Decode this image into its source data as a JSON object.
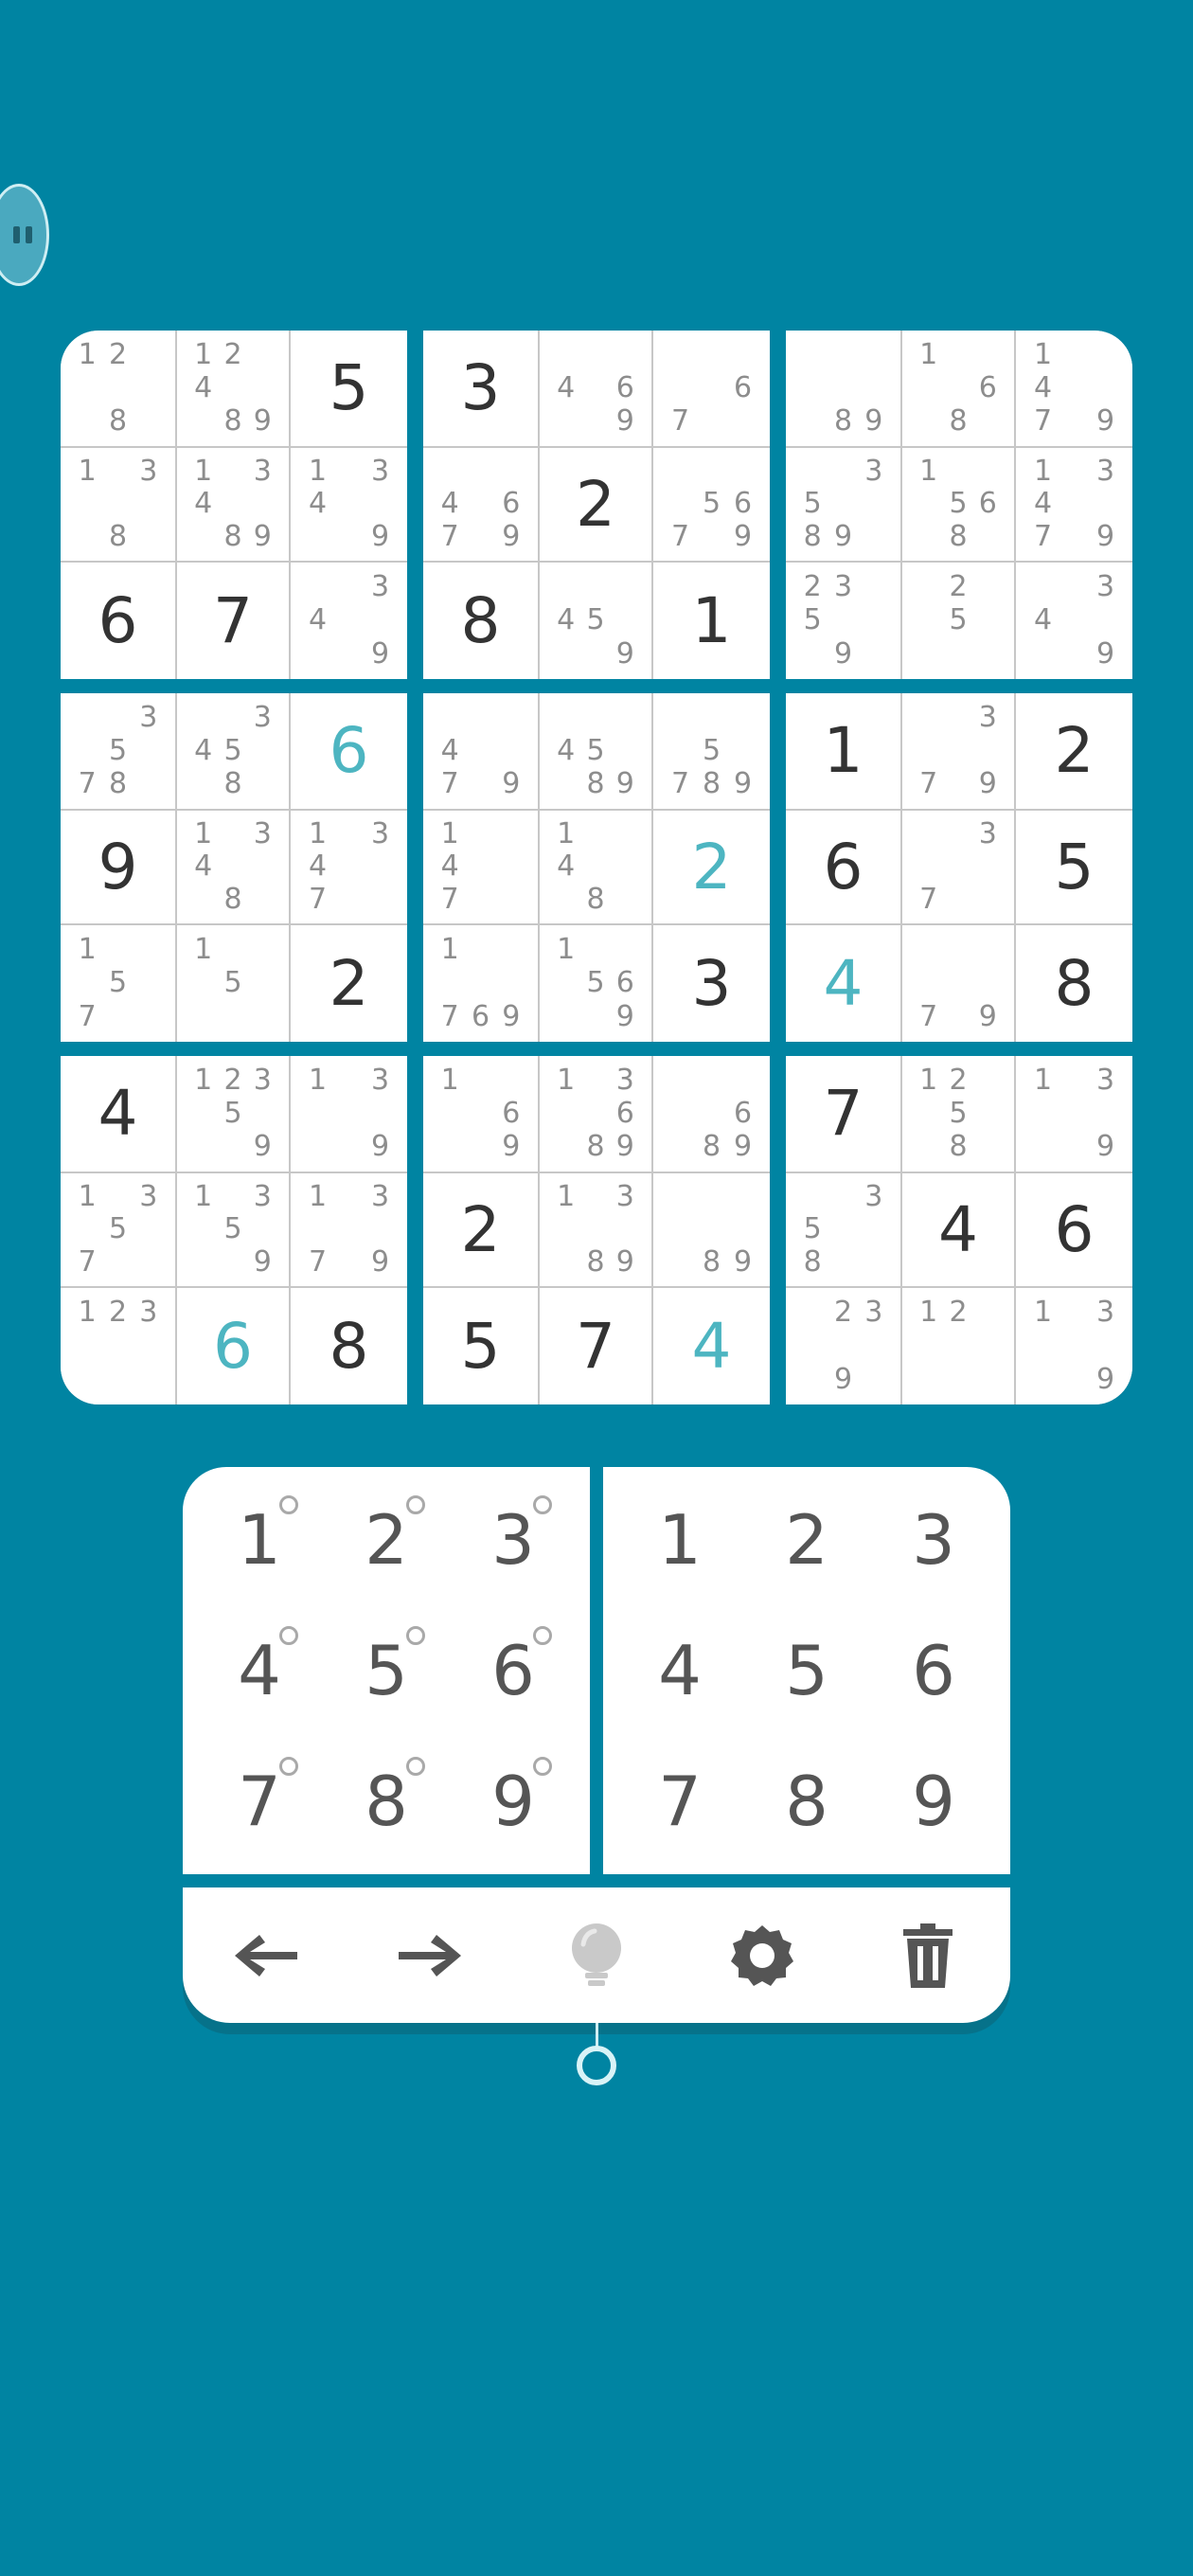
{
  "colors": {
    "background": "#0084a2",
    "given": "#333333",
    "user": "#4db5c1",
    "notes": "#8d8d8d",
    "grid": "#c7c7c7"
  },
  "pause_icon": "pause-icon",
  "board": [
    [
      {
        "v": "",
        "notes": [
          "1",
          "2",
          "",
          "",
          "",
          "",
          "",
          "8",
          ""
        ]
      },
      {
        "v": "",
        "notes": [
          "1",
          "2",
          "",
          "4",
          "",
          "",
          "",
          "8",
          "9"
        ]
      },
      {
        "v": "5",
        "t": "given"
      },
      {
        "v": "",
        "notes": [
          "1",
          "",
          "3",
          "",
          "",
          "",
          "",
          "8",
          ""
        ]
      },
      {
        "v": "",
        "notes": [
          "1",
          "",
          "3",
          "4",
          "",
          "",
          "",
          "8",
          "9"
        ]
      },
      {
        "v": "",
        "notes": [
          "1",
          "",
          "3",
          "4",
          "",
          "",
          "",
          "",
          "9"
        ]
      },
      {
        "v": "6",
        "t": "given"
      },
      {
        "v": "7",
        "t": "given"
      },
      {
        "v": "",
        "notes": [
          "",
          "",
          "3",
          "4",
          "",
          "",
          "",
          "",
          "9"
        ]
      }
    ],
    [
      {
        "v": "3",
        "t": "given"
      },
      {
        "v": "",
        "notes": [
          "",
          "",
          "",
          "4",
          "",
          "6",
          "",
          "",
          "9"
        ]
      },
      {
        "v": "",
        "notes": [
          "",
          "",
          "",
          "",
          "",
          "6",
          "7",
          "",
          ""
        ]
      },
      {
        "v": "",
        "notes": [
          "",
          "",
          "",
          "4",
          "",
          "6",
          "7",
          "",
          "9"
        ]
      },
      {
        "v": "2",
        "t": "given"
      },
      {
        "v": "",
        "notes": [
          "",
          "",
          "",
          "",
          "5",
          "6",
          "7",
          "",
          "9"
        ]
      },
      {
        "v": "8",
        "t": "given"
      },
      {
        "v": "",
        "notes": [
          "",
          "",
          "",
          "4",
          "5",
          "",
          "",
          "",
          "9"
        ]
      },
      {
        "v": "1",
        "t": "given"
      }
    ],
    [
      {
        "v": "",
        "notes": [
          "",
          "",
          "",
          "",
          "",
          "",
          "",
          "8",
          "9"
        ]
      },
      {
        "v": "",
        "notes": [
          "1",
          "",
          "",
          "",
          "",
          "6",
          "",
          "8",
          ""
        ]
      },
      {
        "v": "",
        "notes": [
          "1",
          "",
          "",
          "4",
          "",
          "",
          "7",
          "",
          "9"
        ]
      },
      {
        "v": "",
        "notes": [
          "",
          "",
          "3",
          "5",
          "",
          "",
          "8",
          "9",
          ""
        ]
      },
      {
        "v": "",
        "notes": [
          "1",
          "",
          "",
          "",
          "5",
          "6",
          "",
          "8",
          ""
        ]
      },
      {
        "v": "",
        "notes": [
          "1",
          "",
          "3",
          "4",
          "",
          "",
          "7",
          "",
          "9"
        ]
      },
      {
        "v": "",
        "notes": [
          "2",
          "3",
          "",
          "5",
          "",
          "",
          "",
          "9",
          ""
        ]
      },
      {
        "v": "",
        "notes": [
          "",
          "2",
          "",
          "",
          "5",
          "",
          "",
          "",
          ""
        ]
      },
      {
        "v": "",
        "notes": [
          "",
          "",
          "3",
          "4",
          "",
          "",
          "",
          "",
          "9"
        ]
      }
    ],
    [
      {
        "v": "",
        "notes": [
          "",
          "",
          "3",
          "",
          "5",
          "",
          "7",
          "8",
          ""
        ]
      },
      {
        "v": "",
        "notes": [
          "",
          "",
          "3",
          "4",
          "5",
          "",
          "",
          "8",
          ""
        ]
      },
      {
        "v": "6",
        "t": "user"
      },
      {
        "v": "9",
        "t": "given"
      },
      {
        "v": "",
        "notes": [
          "1",
          "",
          "3",
          "4",
          "",
          "",
          "",
          "8",
          ""
        ]
      },
      {
        "v": "",
        "notes": [
          "1",
          "",
          "3",
          "4",
          "",
          "",
          "7",
          "",
          ""
        ]
      },
      {
        "v": "",
        "notes": [
          "1",
          "",
          "",
          "",
          "5",
          "",
          "7",
          "",
          ""
        ]
      },
      {
        "v": "",
        "notes": [
          "1",
          "",
          "",
          "",
          "5",
          "",
          "",
          "",
          ""
        ]
      },
      {
        "v": "2",
        "t": "given"
      }
    ],
    [
      {
        "v": "",
        "notes": [
          "",
          "",
          "",
          "4",
          "",
          "",
          "7",
          "",
          "9"
        ]
      },
      {
        "v": "",
        "notes": [
          "",
          "",
          "",
          "4",
          "5",
          "",
          "",
          "8",
          "9"
        ]
      },
      {
        "v": "",
        "notes": [
          "",
          "",
          "",
          "",
          "5",
          "",
          "7",
          "8",
          "9"
        ]
      },
      {
        "v": "",
        "notes": [
          "1",
          "",
          "",
          "4",
          "",
          "",
          "7",
          "",
          ""
        ]
      },
      {
        "v": "",
        "notes": [
          "1",
          "",
          "",
          "4",
          "",
          "",
          "",
          "8",
          ""
        ]
      },
      {
        "v": "2",
        "t": "user"
      },
      {
        "v": "",
        "notes": [
          "1",
          "",
          "",
          "",
          "",
          "",
          "7",
          "6",
          "9"
        ]
      },
      {
        "v": "",
        "notes": [
          "1",
          "",
          "",
          "",
          "5",
          "6",
          "",
          "",
          "9"
        ]
      },
      {
        "v": "3",
        "t": "given"
      }
    ],
    [
      {
        "v": "1",
        "t": "given"
      },
      {
        "v": "",
        "notes": [
          "",
          "",
          "3",
          "",
          "",
          "",
          "7",
          "",
          "9"
        ]
      },
      {
        "v": "2",
        "t": "given"
      },
      {
        "v": "6",
        "t": "given"
      },
      {
        "v": "",
        "notes": [
          "",
          "",
          "3",
          "",
          "",
          "",
          "7",
          "",
          ""
        ]
      },
      {
        "v": "5",
        "t": "given"
      },
      {
        "v": "4",
        "t": "user"
      },
      {
        "v": "",
        "notes": [
          "",
          "",
          "",
          "",
          "",
          "",
          "7",
          "",
          "9"
        ]
      },
      {
        "v": "8",
        "t": "given"
      }
    ],
    [
      {
        "v": "4",
        "t": "given"
      },
      {
        "v": "",
        "notes": [
          "1",
          "2",
          "3",
          "",
          "5",
          "",
          "",
          "",
          "9"
        ]
      },
      {
        "v": "",
        "notes": [
          "1",
          "",
          "3",
          "",
          "",
          "",
          "",
          "",
          "9"
        ]
      },
      {
        "v": "",
        "notes": [
          "1",
          "",
          "3",
          "",
          "5",
          "",
          "7",
          "",
          ""
        ]
      },
      {
        "v": "",
        "notes": [
          "1",
          "",
          "3",
          "",
          "5",
          "",
          "",
          "",
          "9"
        ]
      },
      {
        "v": "",
        "notes": [
          "1",
          "",
          "3",
          "",
          "",
          "",
          "7",
          "",
          "9"
        ]
      },
      {
        "v": "",
        "notes": [
          "1",
          "2",
          "3",
          "",
          "",
          "",
          "",
          "",
          ""
        ]
      },
      {
        "v": "6",
        "t": "user"
      },
      {
        "v": "8",
        "t": "given"
      }
    ],
    [
      {
        "v": "",
        "notes": [
          "1",
          "",
          "",
          "",
          "",
          "6",
          "",
          "",
          "9"
        ]
      },
      {
        "v": "",
        "notes": [
          "1",
          "",
          "3",
          "",
          "",
          "6",
          "",
          "8",
          "9"
        ]
      },
      {
        "v": "",
        "notes": [
          "",
          "",
          "",
          "",
          "",
          "6",
          "",
          "8",
          "9"
        ]
      },
      {
        "v": "2",
        "t": "given"
      },
      {
        "v": "",
        "notes": [
          "1",
          "",
          "3",
          "",
          "",
          "",
          "",
          "8",
          "9"
        ]
      },
      {
        "v": "",
        "notes": [
          "",
          "",
          "",
          "",
          "",
          "",
          "",
          "8",
          "9"
        ]
      },
      {
        "v": "5",
        "t": "given"
      },
      {
        "v": "7",
        "t": "given"
      },
      {
        "v": "4",
        "t": "user"
      }
    ],
    [
      {
        "v": "7",
        "t": "given"
      },
      {
        "v": "",
        "notes": [
          "1",
          "2",
          "",
          "",
          "5",
          "",
          "",
          "8",
          ""
        ]
      },
      {
        "v": "",
        "notes": [
          "1",
          "",
          "3",
          "",
          "",
          "",
          "",
          "",
          "9"
        ]
      },
      {
        "v": "",
        "notes": [
          "",
          "",
          "3",
          "5",
          "",
          "",
          "8",
          "",
          ""
        ]
      },
      {
        "v": "4",
        "t": "given"
      },
      {
        "v": "6",
        "t": "given"
      },
      {
        "v": "",
        "notes": [
          "",
          "2",
          "3",
          "",
          "",
          "",
          "",
          "9",
          ""
        ]
      },
      {
        "v": "",
        "notes": [
          "1",
          "2",
          "",
          "",
          "",
          "",
          "",
          "",
          ""
        ]
      },
      {
        "v": "",
        "notes": [
          "1",
          "",
          "3",
          "",
          "",
          "",
          "",
          "",
          "9"
        ]
      }
    ]
  ],
  "notes_pad": [
    "1",
    "2",
    "3",
    "4",
    "5",
    "6",
    "7",
    "8",
    "9"
  ],
  "value_pad": [
    "1",
    "2",
    "3",
    "4",
    "5",
    "6",
    "7",
    "8",
    "9"
  ],
  "toolbar": [
    {
      "name": "undo-button",
      "icon": "arrow-left-icon"
    },
    {
      "name": "redo-button",
      "icon": "arrow-right-icon"
    },
    {
      "name": "hint-button",
      "icon": "lightbulb-icon"
    },
    {
      "name": "settings-button",
      "icon": "gear-icon"
    },
    {
      "name": "delete-button",
      "icon": "trash-icon"
    }
  ]
}
